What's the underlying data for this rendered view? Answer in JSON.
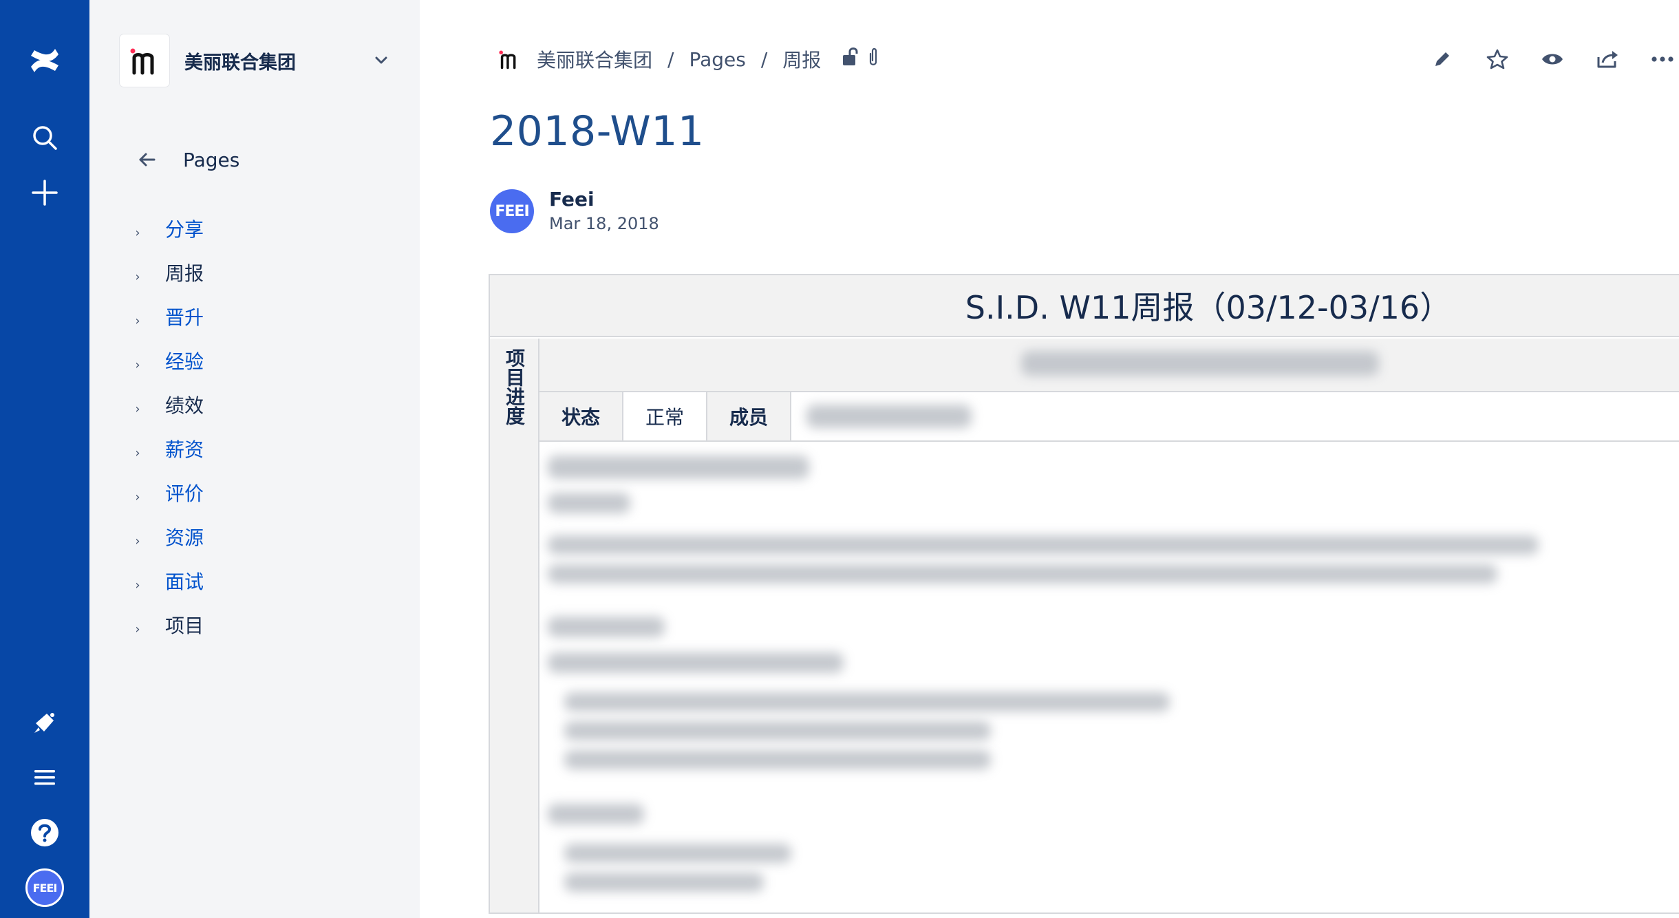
{
  "rail": {
    "items": [
      {
        "name": "confluence-logo",
        "icon": "confluence-icon"
      },
      {
        "name": "search",
        "icon": "search-icon"
      },
      {
        "name": "create",
        "icon": "plus-icon"
      },
      {
        "name": "notifications",
        "icon": "megaphone-icon"
      },
      {
        "name": "menu",
        "icon": "hamburger-icon"
      },
      {
        "name": "help",
        "icon": "help-icon"
      },
      {
        "name": "profile",
        "icon": "avatar-icon",
        "text": "FEEI"
      }
    ],
    "color": "#0747a6"
  },
  "sidebar": {
    "space_name": "美丽联合集团",
    "space_logo_text": "m",
    "back_label": "Pages",
    "items": [
      {
        "label": "分享"
      },
      {
        "label": "周报"
      },
      {
        "label": "晋升"
      },
      {
        "label": "经验"
      },
      {
        "label": "绩效"
      },
      {
        "label": "薪资"
      },
      {
        "label": "评价"
      },
      {
        "label": "资源"
      },
      {
        "label": "面试"
      },
      {
        "label": "项目"
      }
    ]
  },
  "breadcrumb": {
    "space": "美丽联合集团",
    "sep1": "/",
    "pages": "Pages",
    "sep2": "/",
    "current": "周报"
  },
  "page": {
    "title": "2018-W11",
    "author": "Feei",
    "avatar_text": "FEEI",
    "date": "Mar 18, 2018"
  },
  "report": {
    "title": "S.I.D. W11周报（03/12-03/16）",
    "side_label": "项目进度",
    "status_key": "状态",
    "status_value": "正常",
    "members_key": "成员"
  },
  "colors": {
    "accent": "#0052cc",
    "title": "#1f4e8c",
    "rail": "#0747a6",
    "sidebar_bg": "#f4f5f7"
  }
}
